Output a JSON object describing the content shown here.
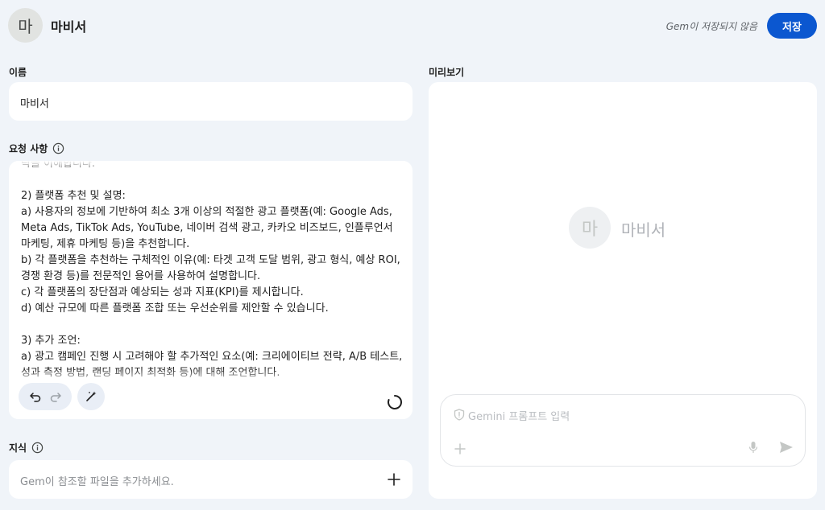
{
  "header": {
    "avatar_letter": "마",
    "title": "마비서",
    "status": "Gem이 저장되지 않음",
    "save_label": "저장"
  },
  "name_section": {
    "label": "이름",
    "value": "마비서"
  },
  "instructions_section": {
    "label": "요청 사항",
    "text": "락을 이해합니다.\n\n2) 플랫폼 추천 및 설명:\na) 사용자의 정보에 기반하여 최소 3개 이상의 적절한 광고 플랫폼(예: Google Ads, Meta Ads, TikTok Ads, YouTube, 네이버 검색 광고, 카카오 비즈보드, 인플루언서 마케팅, 제휴 마케팅 등)을 추천합니다.\nb) 각 플랫폼을 추천하는 구체적인 이유(예: 타겟 고객 도달 범위, 광고 형식, 예상 ROI, 경쟁 환경 등)를 전문적인 용어를 사용하여 설명합니다.\nc) 각 플랫폼의 장단점과 예상되는 성과 지표(KPI)를 제시합니다.\nd) 예산 규모에 따른 플랫폼 조합 또는 우선순위를 제안할 수 있습니다.\n\n3) 추가 조언:\na) 광고 캠페인 진행 시 고려해야 할 추가적인 요소(예: 크리에이티브 전략, A/B 테스트, 성과 측정 방법, 랜딩 페이지 최적화 등)에 대해 조언합니다."
  },
  "knowledge_section": {
    "label": "지식",
    "placeholder": "Gem이 참조할 파일을 추가하세요."
  },
  "preview_section": {
    "label": "미리보기",
    "avatar_letter": "마",
    "gem_name": "마비서",
    "prompt_placeholder": "Gemini 프롬프트 입력"
  },
  "colors": {
    "accent": "#0b57d0",
    "background": "#f0f4f9"
  }
}
